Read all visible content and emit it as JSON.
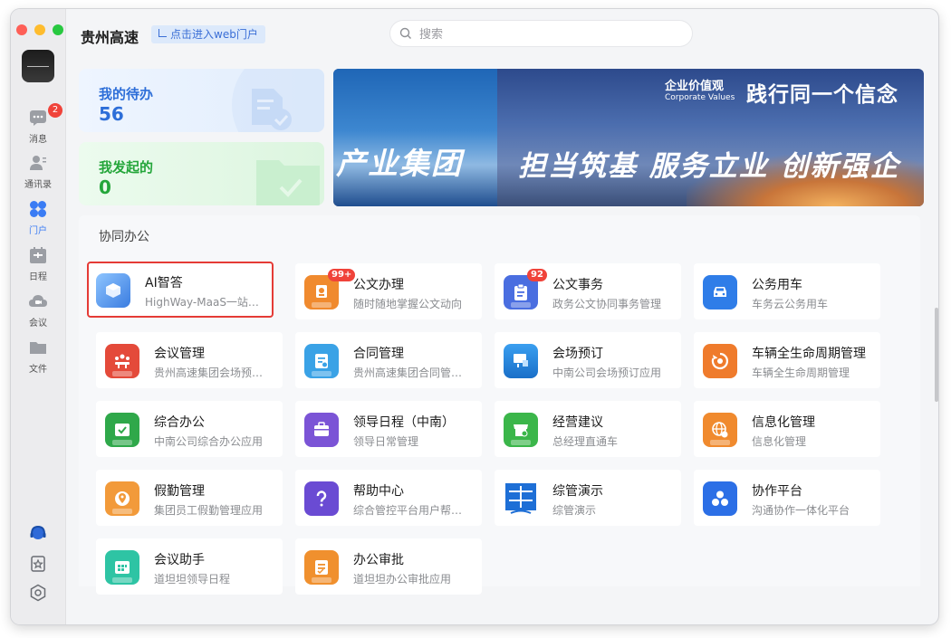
{
  "sidebar": {
    "items": [
      {
        "label": "消息",
        "badge": "2",
        "icon": "message-icon"
      },
      {
        "label": "通讯录",
        "icon": "contacts-icon"
      },
      {
        "label": "门户",
        "icon": "portal-icon",
        "active": true
      },
      {
        "label": "日程",
        "icon": "calendar-icon"
      },
      {
        "label": "会议",
        "icon": "meeting-icon"
      },
      {
        "label": "文件",
        "icon": "folder-icon"
      }
    ],
    "bottom_icons": [
      "headset-icon",
      "favorite-icon",
      "settings-icon"
    ]
  },
  "header": {
    "title": "贵州高速",
    "web_button": "点击进入web门户",
    "search_placeholder": "搜索"
  },
  "stats": {
    "todo": {
      "label": "我的待办",
      "value": "56"
    },
    "initiated": {
      "label": "我发起的",
      "value": "0"
    }
  },
  "banner": {
    "corporate_values": "企业价值观",
    "corporate_values_en": "Corporate Values",
    "motto_top": "践行同一个信念",
    "motto_left": "产业集团",
    "motto_right": "担当筑基 服务立业 创新强企"
  },
  "section": {
    "title": "协同办公"
  },
  "apps": [
    {
      "title": "AI智答",
      "desc": "HighWay-MaaS一站…",
      "color": "#4a8be8"
    },
    {
      "title": "公文办理",
      "desc": "随时随地掌握公文动向",
      "badge": "99+",
      "color": "#f08a2e"
    },
    {
      "title": "公文事务",
      "desc": "政务公文协同事务管理",
      "badge": "92",
      "color": "#4a6ee0"
    },
    {
      "title": "公务用车",
      "desc": "车务云公务用车",
      "color": "#2f7de8"
    },
    {
      "title": "会议管理",
      "desc": "贵州高速集团会场预…",
      "color": "#e44a3a"
    },
    {
      "title": "合同管理",
      "desc": "贵州高速集团合同管…",
      "color": "#3aa2e6"
    },
    {
      "title": "会场预订",
      "desc": "中南公司会场预订应用",
      "color": "#2c8fd8"
    },
    {
      "title": "车辆全生命周期管理",
      "desc": "车辆全生命周期管理",
      "color": "#ef7b2c"
    },
    {
      "title": "综合办公",
      "desc": "中南公司综合办公应用",
      "color": "#2fa84a"
    },
    {
      "title": "领导日程（中南）",
      "desc": "领导日常管理",
      "color": "#7b54d6"
    },
    {
      "title": "经营建议",
      "desc": "总经理直通车",
      "color": "#3bb64a"
    },
    {
      "title": "信息化管理",
      "desc": "信息化管理",
      "color": "#f08a2e"
    },
    {
      "title": "假勤管理",
      "desc": "集团员工假勤管理应用",
      "color": "#f29a3a"
    },
    {
      "title": "帮助中心",
      "desc": "综合管控平台用户帮…",
      "color": "#6a4bd3"
    },
    {
      "title": "综管演示",
      "desc": "综管演示",
      "color": "#1e6fd6"
    },
    {
      "title": "协作平台",
      "desc": "沟通协作一体化平台",
      "color": "#2c6fe6"
    },
    {
      "title": "会议助手",
      "desc": "道坦坦领导日程",
      "color": "#2ec4a4"
    },
    {
      "title": "办公审批",
      "desc": "道坦坦办公审批应用",
      "color": "#f0902e"
    }
  ]
}
